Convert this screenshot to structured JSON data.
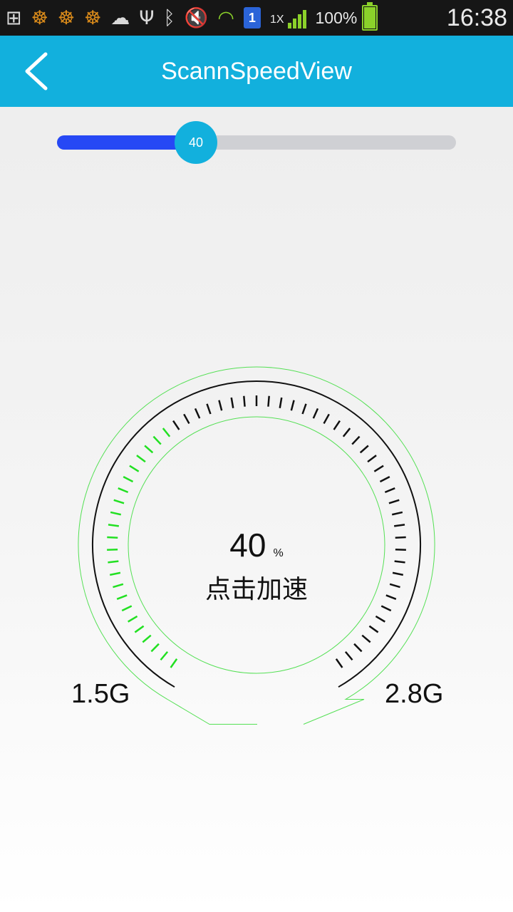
{
  "status_bar": {
    "icons": [
      "add-notification-icon",
      "uc-browser-icon",
      "uc-browser-icon",
      "uc-browser-icon",
      "weather-rain-icon",
      "usb-icon",
      "bluetooth-icon",
      "mute-icon",
      "wifi-icon"
    ],
    "sim_number": "1",
    "network_type": "1X",
    "battery_percent": "100%",
    "time": "16:38"
  },
  "app_bar": {
    "title": "ScannSpeedView",
    "back_icon": "chevron-left-icon"
  },
  "slider": {
    "value": 40,
    "label": "40",
    "max": 100,
    "colors": {
      "fill": "#2648f5",
      "track": "#cfd0d4",
      "thumb": "#12b0dd"
    }
  },
  "gauge": {
    "value": 40,
    "value_text": "40",
    "unit": "%",
    "action_label": "点击加速",
    "min_label": "1.5G",
    "max_label": "2.8G",
    "colors": {
      "active_tick": "#22e022",
      "inactive_tick": "#111111",
      "outline": "#55e055",
      "arc": "#111111"
    }
  },
  "colors": {
    "accent": "#12b0dd",
    "status_bar": "#161616"
  }
}
